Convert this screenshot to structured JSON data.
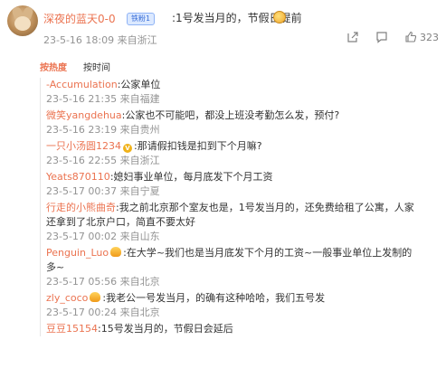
{
  "post": {
    "username": "深夜的蓝天0-0",
    "badge": "铁粉1",
    "text": ":1号发当月的，节假日提前",
    "time": "23-5-16 18:09 来自浙江",
    "like_count": "323"
  },
  "tabs": {
    "hot": "按热度",
    "time": "按时间"
  },
  "replies": [
    {
      "name": "-Accumulation",
      "text": ":公家单位",
      "time": "23-5-16 21:35 来自福建"
    },
    {
      "name": "微笑yangdehua",
      "text": ":公家也不可能吧，都没上班没考勤怎么发，预付?",
      "time": "23-5-16 23:19 来自贵州"
    },
    {
      "name": "一只小汤圆1234",
      "text": ":那请假扣钱是扣到下个月嘛?",
      "time": "23-5-16 22:55 来自浙江"
    },
    {
      "name": "Yeats870110",
      "text": ":媳妇事业单位，每月底发下个月工资",
      "time": "23-5-17 00:37 来自宁夏"
    },
    {
      "name": "行走的小熊曲奇",
      "text": ":我之前北京那个室友也是，1号发当月的，还免费给租了公寓，人家",
      "text2": "还拿到了北京户口，简直不要太好",
      "time": "23-5-17 00:02 来自山东"
    },
    {
      "name": "Penguin_Luo",
      "text": ":在大学~我们也是当月底发下个月的工资~一般事业单位上发制的",
      "text2": "多~",
      "time": "23-5-17 05:56 来自北京"
    },
    {
      "name": "zly_coco",
      "text": ":我老公一号发当月，的确有这种哈哈，我们五号发",
      "time": "23-5-17 00:24 来自北京"
    },
    {
      "name": "豆豆15154",
      "text": ":15号发当月的，节假日会延后"
    }
  ]
}
